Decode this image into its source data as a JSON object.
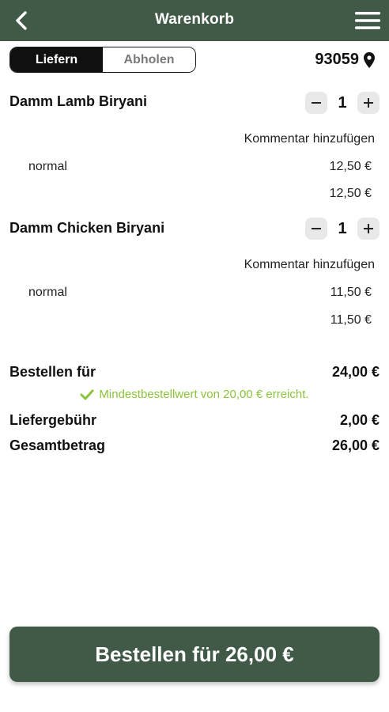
{
  "header": {
    "title": "Warenkorb",
    "back_icon": "chevron-left-icon",
    "menu_icon": "hamburger-menu-icon",
    "color": "#415a47"
  },
  "delivery_toggle": {
    "options": [
      "Liefern",
      "Abholen"
    ],
    "selected": "Liefern"
  },
  "location": {
    "postal_code": "93059",
    "icon": "location-pin-icon"
  },
  "cart": {
    "items": [
      {
        "name": "Damm Lamb Biryani",
        "quantity": "1",
        "comment_link": "Kommentar hinzufügen",
        "variant": "normal",
        "variant_price": "12,50 €",
        "total": "12,50 €"
      },
      {
        "name": "Damm Chicken Biryani",
        "quantity": "1",
        "comment_link": "Kommentar hinzufügen",
        "variant": "normal",
        "variant_price": "11,50 €",
        "total": "11,50 €"
      }
    ]
  },
  "summary": {
    "order_for_label": "Bestellen für",
    "order_for_value": "24,00 €",
    "minimum_note": "Mindestbestellwert von 20,00 € erreicht.",
    "minimum_color": "#8bc43a",
    "delivery_fee_label": "Liefergebühr",
    "delivery_fee_value": "2,00 €",
    "total_label": "Gesamtbetrag",
    "total_value": "26,00 €"
  },
  "checkout": {
    "button_label": "Bestellen für 26,00 €"
  }
}
